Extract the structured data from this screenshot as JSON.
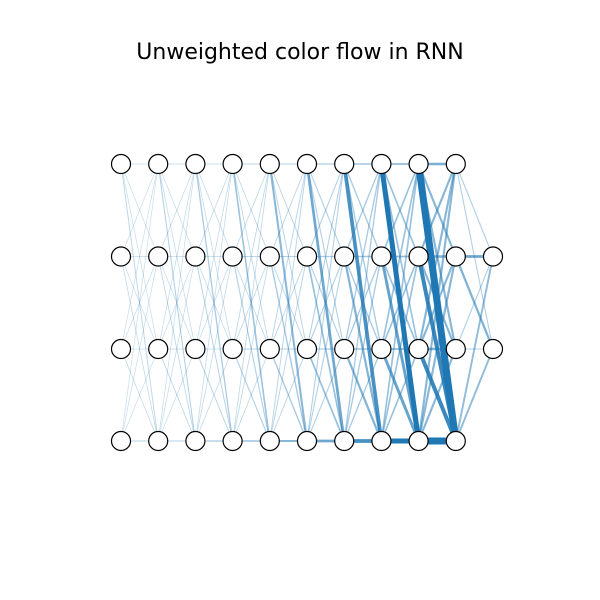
{
  "title": "Unweighted color flow in RNN",
  "colors": {
    "edge": "#1f77b4",
    "node_fill": "#ffffff",
    "node_stroke": "#000000",
    "background": "#ffffff"
  },
  "network": {
    "layers": [
      {
        "nodes": 4
      },
      {
        "nodes": 4
      },
      {
        "nodes": 4
      },
      {
        "nodes": 4
      },
      {
        "nodes": 4
      },
      {
        "nodes": 4
      },
      {
        "nodes": 4
      },
      {
        "nodes": 4
      },
      {
        "nodes": 4
      },
      {
        "nodes": 4
      },
      {
        "nodes": 2
      }
    ],
    "edge_pattern": "fully-connected between consecutive layers; flow strength grows toward the output",
    "flow_growth": 1.45
  }
}
